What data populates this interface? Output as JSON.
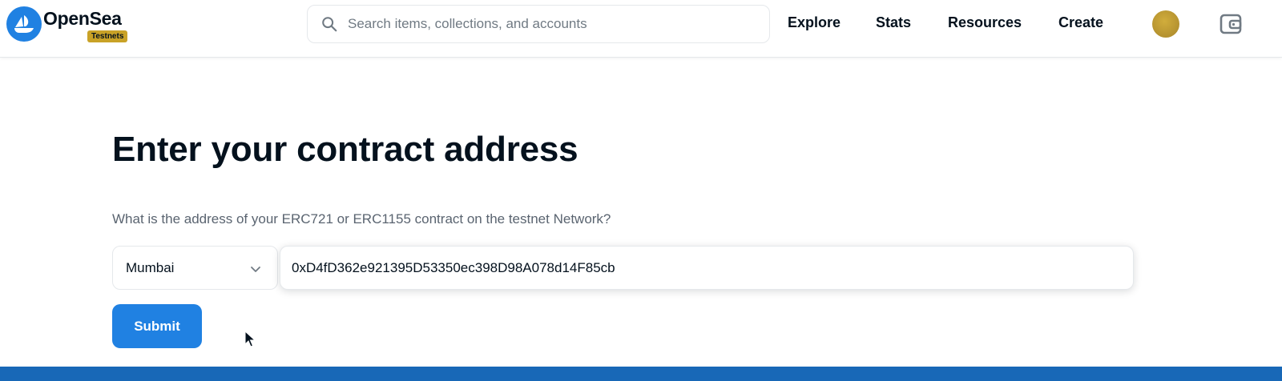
{
  "header": {
    "brand_name": "OpenSea",
    "badge": "Testnets",
    "search_placeholder": "Search items, collections, and accounts",
    "nav": [
      "Explore",
      "Stats",
      "Resources",
      "Create"
    ],
    "icons": {
      "logo": "opensea-logo-icon",
      "search": "search-icon",
      "avatar": "avatar",
      "wallet": "wallet-icon"
    }
  },
  "main": {
    "title": "Enter your contract address",
    "description": "What is the address of your ERC721 or ERC1155 contract on the testnet Network?",
    "network_select": {
      "value": "Mumbai"
    },
    "address_input": {
      "value": "0xD4fD362e921395D53350ec398D98A078d14F85cb"
    },
    "submit_label": "Submit"
  },
  "colors": {
    "primary": "#2081e2",
    "badge": "#c9a227",
    "text": "#04111d",
    "muted": "#5a6470",
    "footer": "#1868b7"
  }
}
